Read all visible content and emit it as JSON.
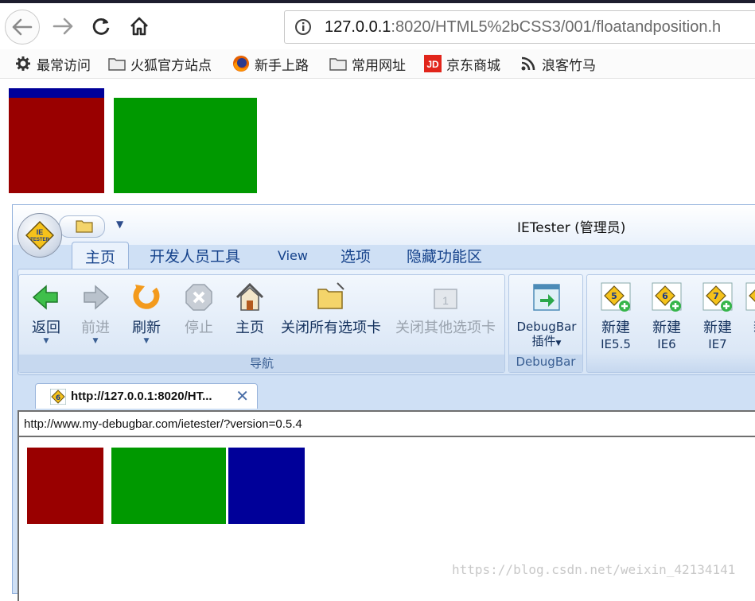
{
  "browser": {
    "address": {
      "host": "127.0.0.1",
      "rest": ":8020/HTML5%2bCSS3/001/floatandposition.h"
    },
    "bookmarks": [
      {
        "label": "最常访问",
        "icon": "gear-icon"
      },
      {
        "label": "火狐官方站点",
        "icon": "folder-icon"
      },
      {
        "label": "新手上路",
        "icon": "firefox-icon"
      },
      {
        "label": "常用网址",
        "icon": "folder-icon"
      },
      {
        "label": "京东商城",
        "icon": "jd-icon"
      },
      {
        "label": "浪客竹马",
        "icon": "rss-icon"
      }
    ]
  },
  "page": {
    "colors": {
      "red": "#990000",
      "green": "#009900",
      "blue": "#000099"
    }
  },
  "ietester": {
    "title": "IETester (管理员)",
    "tabs": [
      "主页",
      "开发人员工具",
      "View",
      "选项",
      "隐藏功能区"
    ],
    "nav_buttons": [
      "返回",
      "前进",
      "刷新",
      "停止",
      "主页",
      "关闭所有选项卡",
      "关闭其他选项卡"
    ],
    "nav_group_label": "导航",
    "debugbar_button": [
      "DebugBar",
      "插件"
    ],
    "debugbar_group_label": "DebugBar",
    "new_buttons": [
      {
        "label": "新建",
        "version": "IE5.5",
        "num": "5"
      },
      {
        "label": "新建",
        "version": "IE6",
        "num": "6"
      },
      {
        "label": "新建",
        "version": "IE7",
        "num": "7"
      },
      {
        "label": "新",
        "version": "",
        "num": "8"
      }
    ],
    "doc_tab_title": "http://127.0.0.1:8020/HT...",
    "doc_tab_ie_num": "6",
    "address_url": "http://www.my-debugbar.com/ietester/?version=0.5.4"
  },
  "watermark": "https://blog.csdn.net/weixin_42134141"
}
